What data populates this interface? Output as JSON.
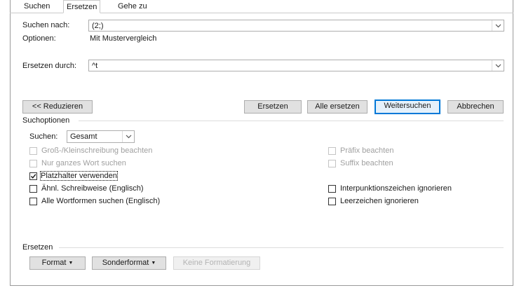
{
  "tabs": [
    {
      "label": "Suchen"
    },
    {
      "label": "Ersetzen"
    },
    {
      "label": "Gehe zu"
    }
  ],
  "search": {
    "label": "Suchen nach:",
    "value": "(2;)"
  },
  "options": {
    "label": "Optionen:",
    "value": "Mit Mustervergleich"
  },
  "replace": {
    "label": "Ersetzen durch:",
    "value": "^t"
  },
  "buttons": {
    "reduce": "<< Reduzieren",
    "replace": "Ersetzen",
    "replace_all": "Alle ersetzen",
    "find_next": "Weitersuchen",
    "cancel": "Abbrechen"
  },
  "search_options": {
    "header": "Suchoptionen",
    "direction_label": "Suchen:",
    "direction_value": "Gesamt",
    "left": [
      {
        "label": "Groß-/Kleinschreibung beachten",
        "checked": false,
        "enabled": false
      },
      {
        "label": "Nur ganzes Wort suchen",
        "checked": false,
        "enabled": false
      },
      {
        "label": "Platzhalter verwenden",
        "checked": true,
        "enabled": true
      },
      {
        "label": "Ähnl. Schreibweise (Englisch)",
        "checked": false,
        "enabled": true
      },
      {
        "label": "Alle Wortformen suchen (Englisch)",
        "checked": false,
        "enabled": true
      }
    ],
    "right": [
      {
        "label": "Präfix beachten",
        "checked": false,
        "enabled": false
      },
      {
        "label": "Suffix beachten",
        "checked": false,
        "enabled": false
      },
      {
        "label": "Interpunktionszeichen ignorieren",
        "checked": false,
        "enabled": true
      },
      {
        "label": "Leerzeichen ignorieren",
        "checked": false,
        "enabled": true
      }
    ]
  },
  "replace_section": {
    "header": "Ersetzen",
    "format": "Format",
    "special": "Sonderformat",
    "no_format": "Keine Formatierung"
  },
  "colors": {
    "accent": "#0078d7"
  }
}
